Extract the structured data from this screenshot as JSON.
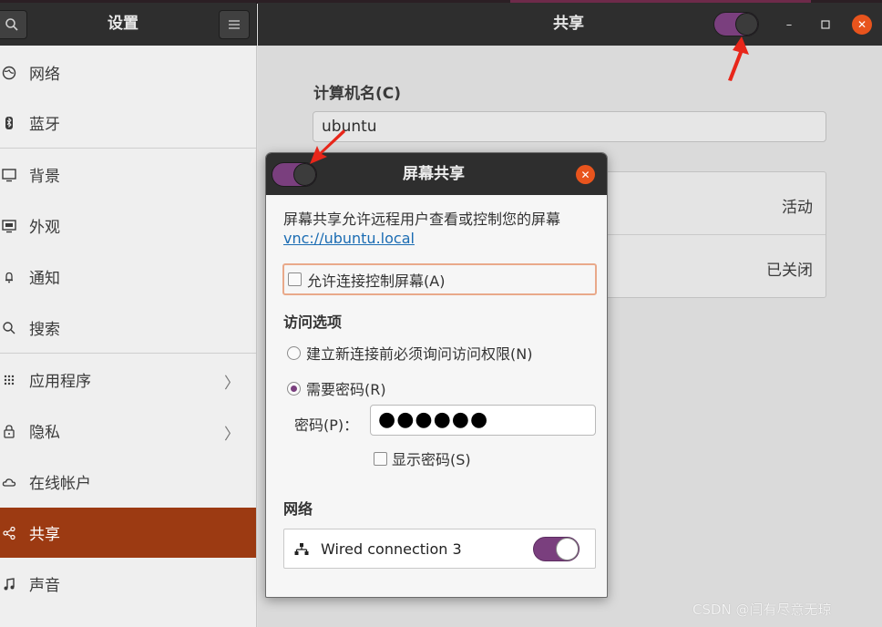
{
  "header": {
    "left_title": "设置",
    "right_title": "共享",
    "sharing_enabled": true
  },
  "sidebar": {
    "items": [
      {
        "label": "网络",
        "icon": "network-icon"
      },
      {
        "label": "蓝牙",
        "icon": "bluetooth-icon"
      },
      {
        "label": "背景",
        "icon": "background-icon"
      },
      {
        "label": "外观",
        "icon": "appearance-icon"
      },
      {
        "label": "通知",
        "icon": "bell-icon"
      },
      {
        "label": "搜索",
        "icon": "search-icon"
      },
      {
        "label": "应用程序",
        "icon": "apps-grid-icon"
      },
      {
        "label": "隐私",
        "icon": "lock-icon"
      },
      {
        "label": "在线帐户",
        "icon": "cloud-icon"
      },
      {
        "label": "共享",
        "icon": "share-icon"
      },
      {
        "label": "声音",
        "icon": "music-note-icon"
      }
    ],
    "active": "共享"
  },
  "main": {
    "computer_name_label": "计算机名(C)",
    "computer_name_value": "ubuntu",
    "rows": [
      {
        "status": "活动"
      },
      {
        "status": "已关闭"
      }
    ]
  },
  "dialog": {
    "title": "屏幕共享",
    "enabled": true,
    "description": "屏幕共享允许远程用户查看或控制您的屏幕",
    "link": "vnc://ubuntu.local",
    "allow_control_label": "允许连接控制屏幕(A)",
    "allow_control_checked": false,
    "access_section": "访问选项",
    "radio_ask": "建立新连接前必须询问访问权限(N)",
    "radio_password": "需要密码(R)",
    "selected_radio": "需要密码(R)",
    "password_label": "密码(P)：",
    "password_value": "●●●●●●",
    "show_password_label": "显示密码(S)",
    "network_section": "网络",
    "network_connection": "Wired connection 3",
    "network_enabled": true
  },
  "watermark": "CSDN @闫有尽意无琼",
  "colors": {
    "accent_purple": "#7a3f7e",
    "active_item": "#9c3a12",
    "close_orange": "#e8541d",
    "link_blue": "#1b6cb3"
  }
}
